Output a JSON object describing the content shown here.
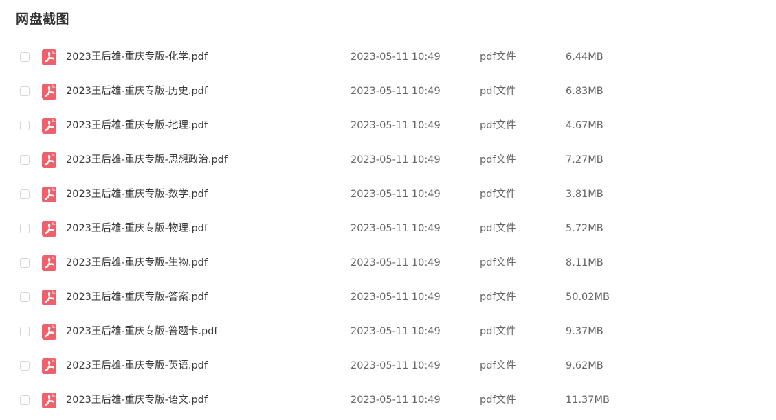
{
  "page": {
    "title": "网盘截图"
  },
  "colors": {
    "pdf_icon": "#f0606b",
    "checkbox_border": "#d6d6d6",
    "text": "#333333"
  },
  "files": [
    {
      "name": "2023王后雄-重庆专版-化学.pdf",
      "date": "2023-05-11 10:49",
      "type": "pdf文件",
      "size": "6.44MB",
      "icon": "pdf-icon"
    },
    {
      "name": "2023王后雄-重庆专版-历史.pdf",
      "date": "2023-05-11 10:49",
      "type": "pdf文件",
      "size": "6.83MB",
      "icon": "pdf-icon"
    },
    {
      "name": "2023王后雄-重庆专版-地理.pdf",
      "date": "2023-05-11 10:49",
      "type": "pdf文件",
      "size": "4.67MB",
      "icon": "pdf-icon"
    },
    {
      "name": "2023王后雄-重庆专版-思想政治.pdf",
      "date": "2023-05-11 10:49",
      "type": "pdf文件",
      "size": "7.27MB",
      "icon": "pdf-icon"
    },
    {
      "name": "2023王后雄-重庆专版-数学.pdf",
      "date": "2023-05-11 10:49",
      "type": "pdf文件",
      "size": "3.81MB",
      "icon": "pdf-icon"
    },
    {
      "name": "2023王后雄-重庆专版-物理.pdf",
      "date": "2023-05-11 10:49",
      "type": "pdf文件",
      "size": "5.72MB",
      "icon": "pdf-icon"
    },
    {
      "name": "2023王后雄-重庆专版-生物.pdf",
      "date": "2023-05-11 10:49",
      "type": "pdf文件",
      "size": "8.11MB",
      "icon": "pdf-icon"
    },
    {
      "name": "2023王后雄-重庆专版-答案.pdf",
      "date": "2023-05-11 10:49",
      "type": "pdf文件",
      "size": "50.02MB",
      "icon": "pdf-icon"
    },
    {
      "name": "2023王后雄-重庆专版-答题卡.pdf",
      "date": "2023-05-11 10:49",
      "type": "pdf文件",
      "size": "9.37MB",
      "icon": "pdf-icon"
    },
    {
      "name": "2023王后雄-重庆专版-英语.pdf",
      "date": "2023-05-11 10:49",
      "type": "pdf文件",
      "size": "9.62MB",
      "icon": "pdf-icon"
    },
    {
      "name": "2023王后雄-重庆专版-语文.pdf",
      "date": "2023-05-11 10:49",
      "type": "pdf文件",
      "size": "11.37MB",
      "icon": "pdf-icon"
    }
  ]
}
